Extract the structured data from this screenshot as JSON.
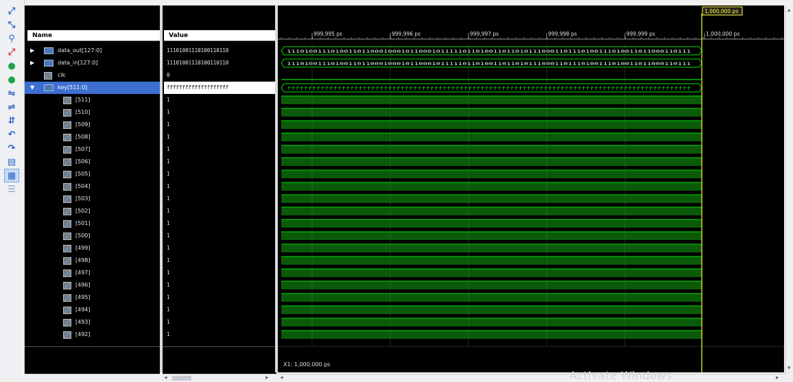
{
  "panes": {
    "name_header": "Name",
    "value_header": "Value"
  },
  "signals": [
    {
      "name": "data_out[127:0]",
      "value": "11101001110100110110",
      "kind": "bus",
      "expandable": true,
      "expanded": false,
      "selected": false,
      "indent": 0
    },
    {
      "name": "data_in[127:0]",
      "value": "11101001110100110110",
      "kind": "bus",
      "expandable": true,
      "expanded": false,
      "selected": false,
      "indent": 0
    },
    {
      "name": "clk",
      "value": "0",
      "kind": "bit",
      "expandable": false,
      "selected": false,
      "indent": 0
    },
    {
      "name": "key[511:0]",
      "value": "ffffffffffffffffffff",
      "kind": "bus",
      "expandable": true,
      "expanded": true,
      "selected": true,
      "indent": 0
    },
    {
      "name": "[511]",
      "value": "1",
      "kind": "bit",
      "indent": 1
    },
    {
      "name": "[510]",
      "value": "1",
      "kind": "bit",
      "indent": 1
    },
    {
      "name": "[509]",
      "value": "1",
      "kind": "bit",
      "indent": 1
    },
    {
      "name": "[508]",
      "value": "1",
      "kind": "bit",
      "indent": 1
    },
    {
      "name": "[507]",
      "value": "1",
      "kind": "bit",
      "indent": 1
    },
    {
      "name": "[506]",
      "value": "1",
      "kind": "bit",
      "indent": 1
    },
    {
      "name": "[505]",
      "value": "1",
      "kind": "bit",
      "indent": 1
    },
    {
      "name": "[504]",
      "value": "1",
      "kind": "bit",
      "indent": 1
    },
    {
      "name": "[503]",
      "value": "1",
      "kind": "bit",
      "indent": 1
    },
    {
      "name": "[502]",
      "value": "1",
      "kind": "bit",
      "indent": 1
    },
    {
      "name": "[501]",
      "value": "1",
      "kind": "bit",
      "indent": 1
    },
    {
      "name": "[500]",
      "value": "1",
      "kind": "bit",
      "indent": 1
    },
    {
      "name": "[499]",
      "value": "1",
      "kind": "bit",
      "indent": 1
    },
    {
      "name": "[498]",
      "value": "1",
      "kind": "bit",
      "indent": 1
    },
    {
      "name": "[497]",
      "value": "1",
      "kind": "bit",
      "indent": 1
    },
    {
      "name": "[496]",
      "value": "1",
      "kind": "bit",
      "indent": 1
    },
    {
      "name": "[495]",
      "value": "1",
      "kind": "bit",
      "indent": 1
    },
    {
      "name": "[494]",
      "value": "1",
      "kind": "bit",
      "indent": 1
    },
    {
      "name": "[493]",
      "value": "1",
      "kind": "bit",
      "indent": 1
    },
    {
      "name": "[492]",
      "value": "1",
      "kind": "bit",
      "indent": 1
    }
  ],
  "waveform": {
    "time_labels": [
      "999,995 ps",
      "999,996 ps",
      "999,997 ps",
      "999,998 ps",
      "999,999 ps",
      "1,000,000 ps"
    ],
    "cursor_label": "1,000,000 ps",
    "cursor_readout": "X1: 1,000,000 ps",
    "data_out_pattern": "11101001110100110110001000101100010111110110100110110101110001101110100111010011011000110111",
    "data_in_pattern": "11101001110100110110001000101100010111110110100110110101110001101110100111010011011000110111",
    "key_pattern": "ffffffffffffffffffffffffffffffffffffffffffffffffffffffffffffffffffffffffffffffffffffffffffffffff",
    "colors": {
      "waveform": "#00e000",
      "bit_fill": "#0a5a0a",
      "cursor": "#ffff33",
      "grid": "#1f4f1f",
      "selection": "#3d6fd0"
    }
  },
  "toolbar_icons": [
    "zoom-in-icon",
    "zoom-out-icon",
    "zoom-fit-icon",
    "zoom-full-icon",
    "go-to-start-icon",
    "go-to-end-icon",
    "swap-cursor-icon",
    "add-marker-icon",
    "previous-transition-icon",
    "next-transition-icon",
    "snap-icon",
    "link-icon",
    "grid-icon",
    "ruler-icon"
  ],
  "watermark": "Activate Windows"
}
